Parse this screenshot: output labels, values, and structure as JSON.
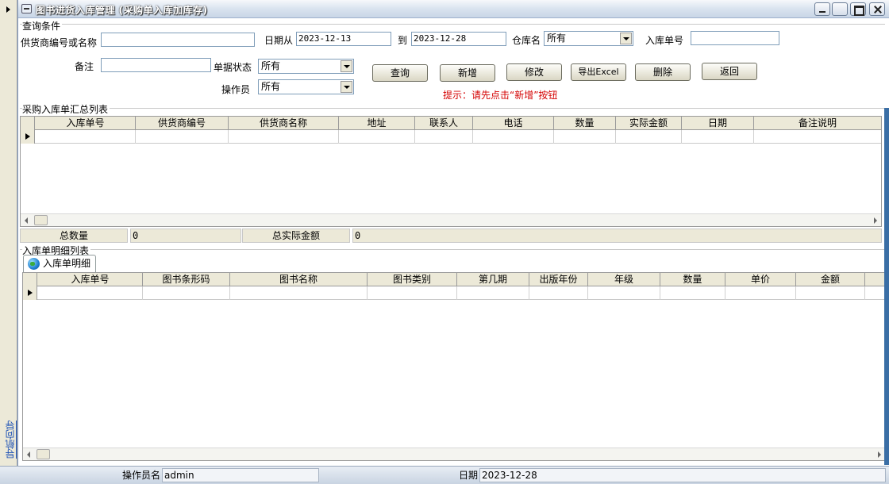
{
  "window": {
    "title": "图书进货入库管理 (采购单入库加库存)"
  },
  "nav": {
    "label": "导航向导"
  },
  "query": {
    "group_label": "查询条件",
    "supplier_label": "供货商编号或名称",
    "supplier_value": "",
    "date_from_label": "日期从",
    "date_from": "2023-12-13",
    "date_to_label": "到",
    "date_to": "2023-12-28",
    "warehouse_label": "仓库名",
    "warehouse_value": "所有",
    "inbound_no_label": "入库单号",
    "inbound_no_value": "",
    "remark_label": "备注",
    "remark_value": "",
    "status_label": "单据状态",
    "status_value": "所有",
    "operator_label": "操作员",
    "operator_value": "所有"
  },
  "buttons": {
    "query": "查询",
    "add": "新增",
    "edit": "修改",
    "export": "导出Excel",
    "delete": "删除",
    "back": "返回"
  },
  "hint": "提示：请先点击“新增”按钮",
  "summary": {
    "group_label": "采购入库单汇总列表",
    "columns": [
      "入库单号",
      "供货商编号",
      "供货商名称",
      "地址",
      "联系人",
      "电话",
      "数量",
      "实际金额",
      "日期",
      "备注说明"
    ],
    "total_qty_label": "总数量",
    "total_qty_value": "0",
    "total_amount_label": "总实际金额",
    "total_amount_value": "0"
  },
  "detail": {
    "group_label": "入库单明细列表",
    "tab_label": "入库单明细",
    "columns": [
      "入库单号",
      "图书条形码",
      "图书名称",
      "图书类别",
      "第几期",
      "出版年份",
      "年级",
      "数量",
      "单价",
      "金额"
    ]
  },
  "statusbar": {
    "operator_label": "操作员名",
    "operator_value": "admin",
    "date_label": "日期",
    "date_value": "2023-12-28"
  }
}
